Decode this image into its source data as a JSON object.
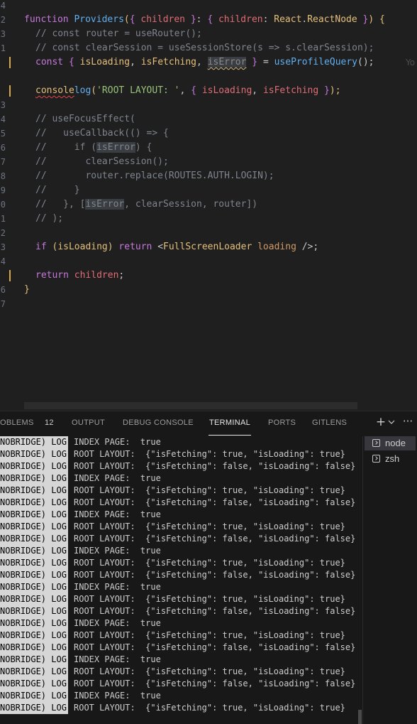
{
  "editor": {
    "line_numbers": [
      "4",
      "",
      "2",
      "3",
      "1",
      "",
      "2",
      "3",
      "4",
      "5",
      "6",
      "7",
      "8",
      "9",
      "0",
      "1",
      "2",
      "3",
      "4",
      "5",
      "6",
      "7"
    ],
    "ghost_text": "Yo",
    "code": {
      "l2": {
        "kw": "function",
        "fn": "Providers",
        "p1": "(",
        "b1": "{ ",
        "pm1": "children",
        "b2": " }",
        "c1": ": ",
        "b3": "{ ",
        "pm2": "children",
        "c2": ": ",
        "ty1": "React",
        "dot": ".",
        "ty2": "ReactNode",
        "b4": " }",
        "p2": ")",
        "sp": " ",
        "b5": "{"
      },
      "l3": "// const router = useRouter();",
      "l4": "// const clearSession = useSessionStore(s => s.clearSession);",
      "l5": {
        "kw": "const ",
        "b1": "{ ",
        "pm1": "isLoading",
        ",1": ", ",
        "pm2": "isFetching",
        ",2": ", ",
        "pm3": "isError",
        "b2": " }",
        "eq": " = ",
        "fn": "useProfileQuery",
        "rest": "();"
      },
      "l7": {
        "obj": "console",
        ".": ".",
        "fn": "log",
        "p1": "(",
        "st": "'ROOT LAYOUT: '",
        "c": ", ",
        "b1": "{ ",
        "pm1": "isLoading",
        "c2": ", ",
        "pm2": "isFetching",
        "b2": " }",
        "p2": ");"
      },
      "l9": "// useFocusEffect(",
      "l10": "//   useCallback(() => {",
      "l11a": "//     if (",
      "l11b": "isError",
      "l11c": ") {",
      "l12": "//       clearSession();",
      "l13": "//       router.replace(ROUTES.AUTH.LOGIN);",
      "l14": "//     }",
      "l15a": "//   }, [",
      "l15b": "isError",
      "l15c": ", clearSession, router])",
      "l16": "// );",
      "l18": {
        "kw1": "if ",
        "p1": "(",
        "pm": "isLoading",
        "p2": ") ",
        "kw2": "return ",
        "lt": "<",
        "comp": "FullScreenLoader",
        "attr": " loading",
        "end": " />;"
      },
      "l20": {
        "kw": "return ",
        "pm": "children",
        "end": ";"
      },
      "l21": "}"
    }
  },
  "panel": {
    "tabs": [
      {
        "label": "OBLEMS"
      },
      {
        "label": "12"
      },
      {
        "label": "OUTPUT"
      },
      {
        "label": "DEBUG CONSOLE"
      },
      {
        "label": "TERMINAL"
      },
      {
        "label": "PORTS"
      },
      {
        "label": "GITLENS"
      }
    ],
    "active_tab": "TERMINAL",
    "actions": {
      "plus": "+",
      "more": "···"
    },
    "sessions": [
      {
        "label": "node"
      },
      {
        "label": "zsh"
      }
    ],
    "terminal": {
      "prefix": "NOBRIDGE) LOG",
      "lines": [
        "INDEX PAGE:  true",
        "ROOT LAYOUT:  {\"isFetching\": true, \"isLoading\": true}",
        "ROOT LAYOUT:  {\"isFetching\": false, \"isLoading\": false}",
        "INDEX PAGE:  true",
        "ROOT LAYOUT:  {\"isFetching\": true, \"isLoading\": true}",
        "ROOT LAYOUT:  {\"isFetching\": false, \"isLoading\": false}",
        "INDEX PAGE:  true",
        "ROOT LAYOUT:  {\"isFetching\": true, \"isLoading\": true}",
        "ROOT LAYOUT:  {\"isFetching\": false, \"isLoading\": false}",
        "INDEX PAGE:  true",
        "ROOT LAYOUT:  {\"isFetching\": true, \"isLoading\": true}",
        "ROOT LAYOUT:  {\"isFetching\": false, \"isLoading\": false}",
        "INDEX PAGE:  true",
        "ROOT LAYOUT:  {\"isFetching\": true, \"isLoading\": true}",
        "ROOT LAYOUT:  {\"isFetching\": false, \"isLoading\": false}",
        "INDEX PAGE:  true",
        "ROOT LAYOUT:  {\"isFetching\": true, \"isLoading\": true}",
        "ROOT LAYOUT:  {\"isFetching\": false, \"isLoading\": false}",
        "INDEX PAGE:  true",
        "ROOT LAYOUT:  {\"isFetching\": true, \"isLoading\": true}",
        "ROOT LAYOUT:  {\"isFetching\": false, \"isLoading\": false}",
        "INDEX PAGE:  true",
        "ROOT LAYOUT:  {\"isFetching\": true, \"isLoading\": true}"
      ]
    }
  },
  "colors": {
    "editor_bg": "#1f1f1f",
    "panel_bg": "#181818",
    "comment": "#7f848e",
    "keyword": "#c678dd",
    "function": "#61afef",
    "param": "#e06c75",
    "type": "#e5c07b",
    "string": "#98c379",
    "modified_gutter": "#d6a94a"
  }
}
